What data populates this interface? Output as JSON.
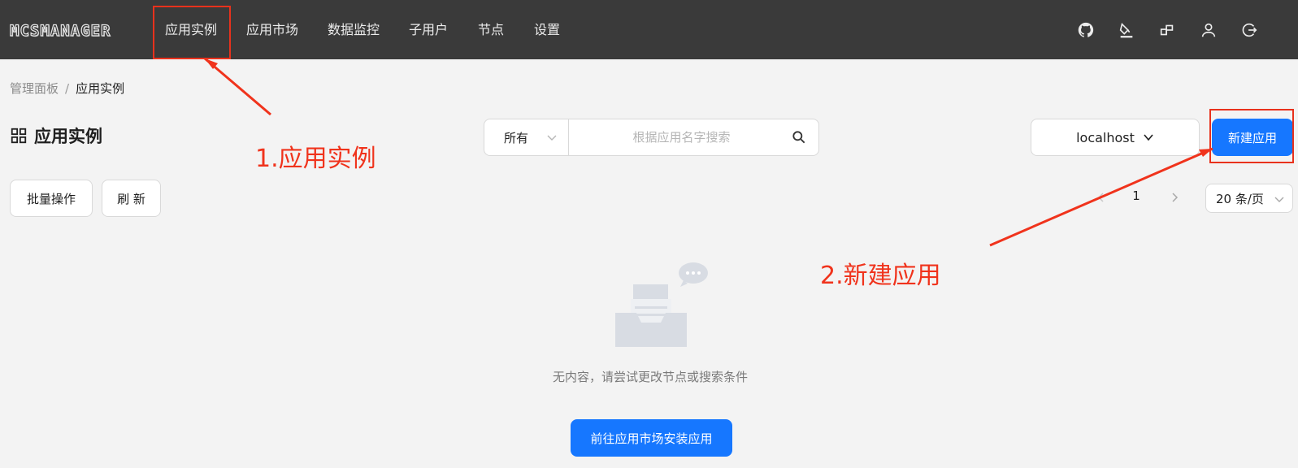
{
  "app": {
    "logo_text": "MCSMANAGER"
  },
  "nav": {
    "items": [
      {
        "label": "应用实例"
      },
      {
        "label": "应用市场"
      },
      {
        "label": "数据监控"
      },
      {
        "label": "子用户"
      },
      {
        "label": "节点"
      },
      {
        "label": "设置"
      }
    ],
    "right_icons": [
      "github-icon",
      "paint-bucket-icon",
      "blocks-icon",
      "user-icon",
      "logout-icon"
    ]
  },
  "breadcrumb": {
    "root": "管理面板",
    "separator": "/",
    "current": "应用实例"
  },
  "page": {
    "title": "应用实例",
    "title_icon": "grid-icon"
  },
  "search": {
    "filter_value": "所有",
    "placeholder": "根据应用名字搜索"
  },
  "node_select": {
    "value": "localhost"
  },
  "toolbar": {
    "new_app_label": "新建应用",
    "batch_label": "批量操作",
    "refresh_label": "刷 新"
  },
  "pagination": {
    "current_page": "1",
    "page_size": "20 条/页"
  },
  "empty": {
    "message": "无内容，请尝试更改节点或搜索条件",
    "goto_market_label": "前往应用市场安装应用"
  },
  "annotations": {
    "step1": "1.应用实例",
    "step2": "2.新建应用",
    "color": "#f0331c"
  },
  "colors": {
    "topbar": "#3a3a3a",
    "primary": "#1677ff",
    "background": "#f3f3f3"
  }
}
